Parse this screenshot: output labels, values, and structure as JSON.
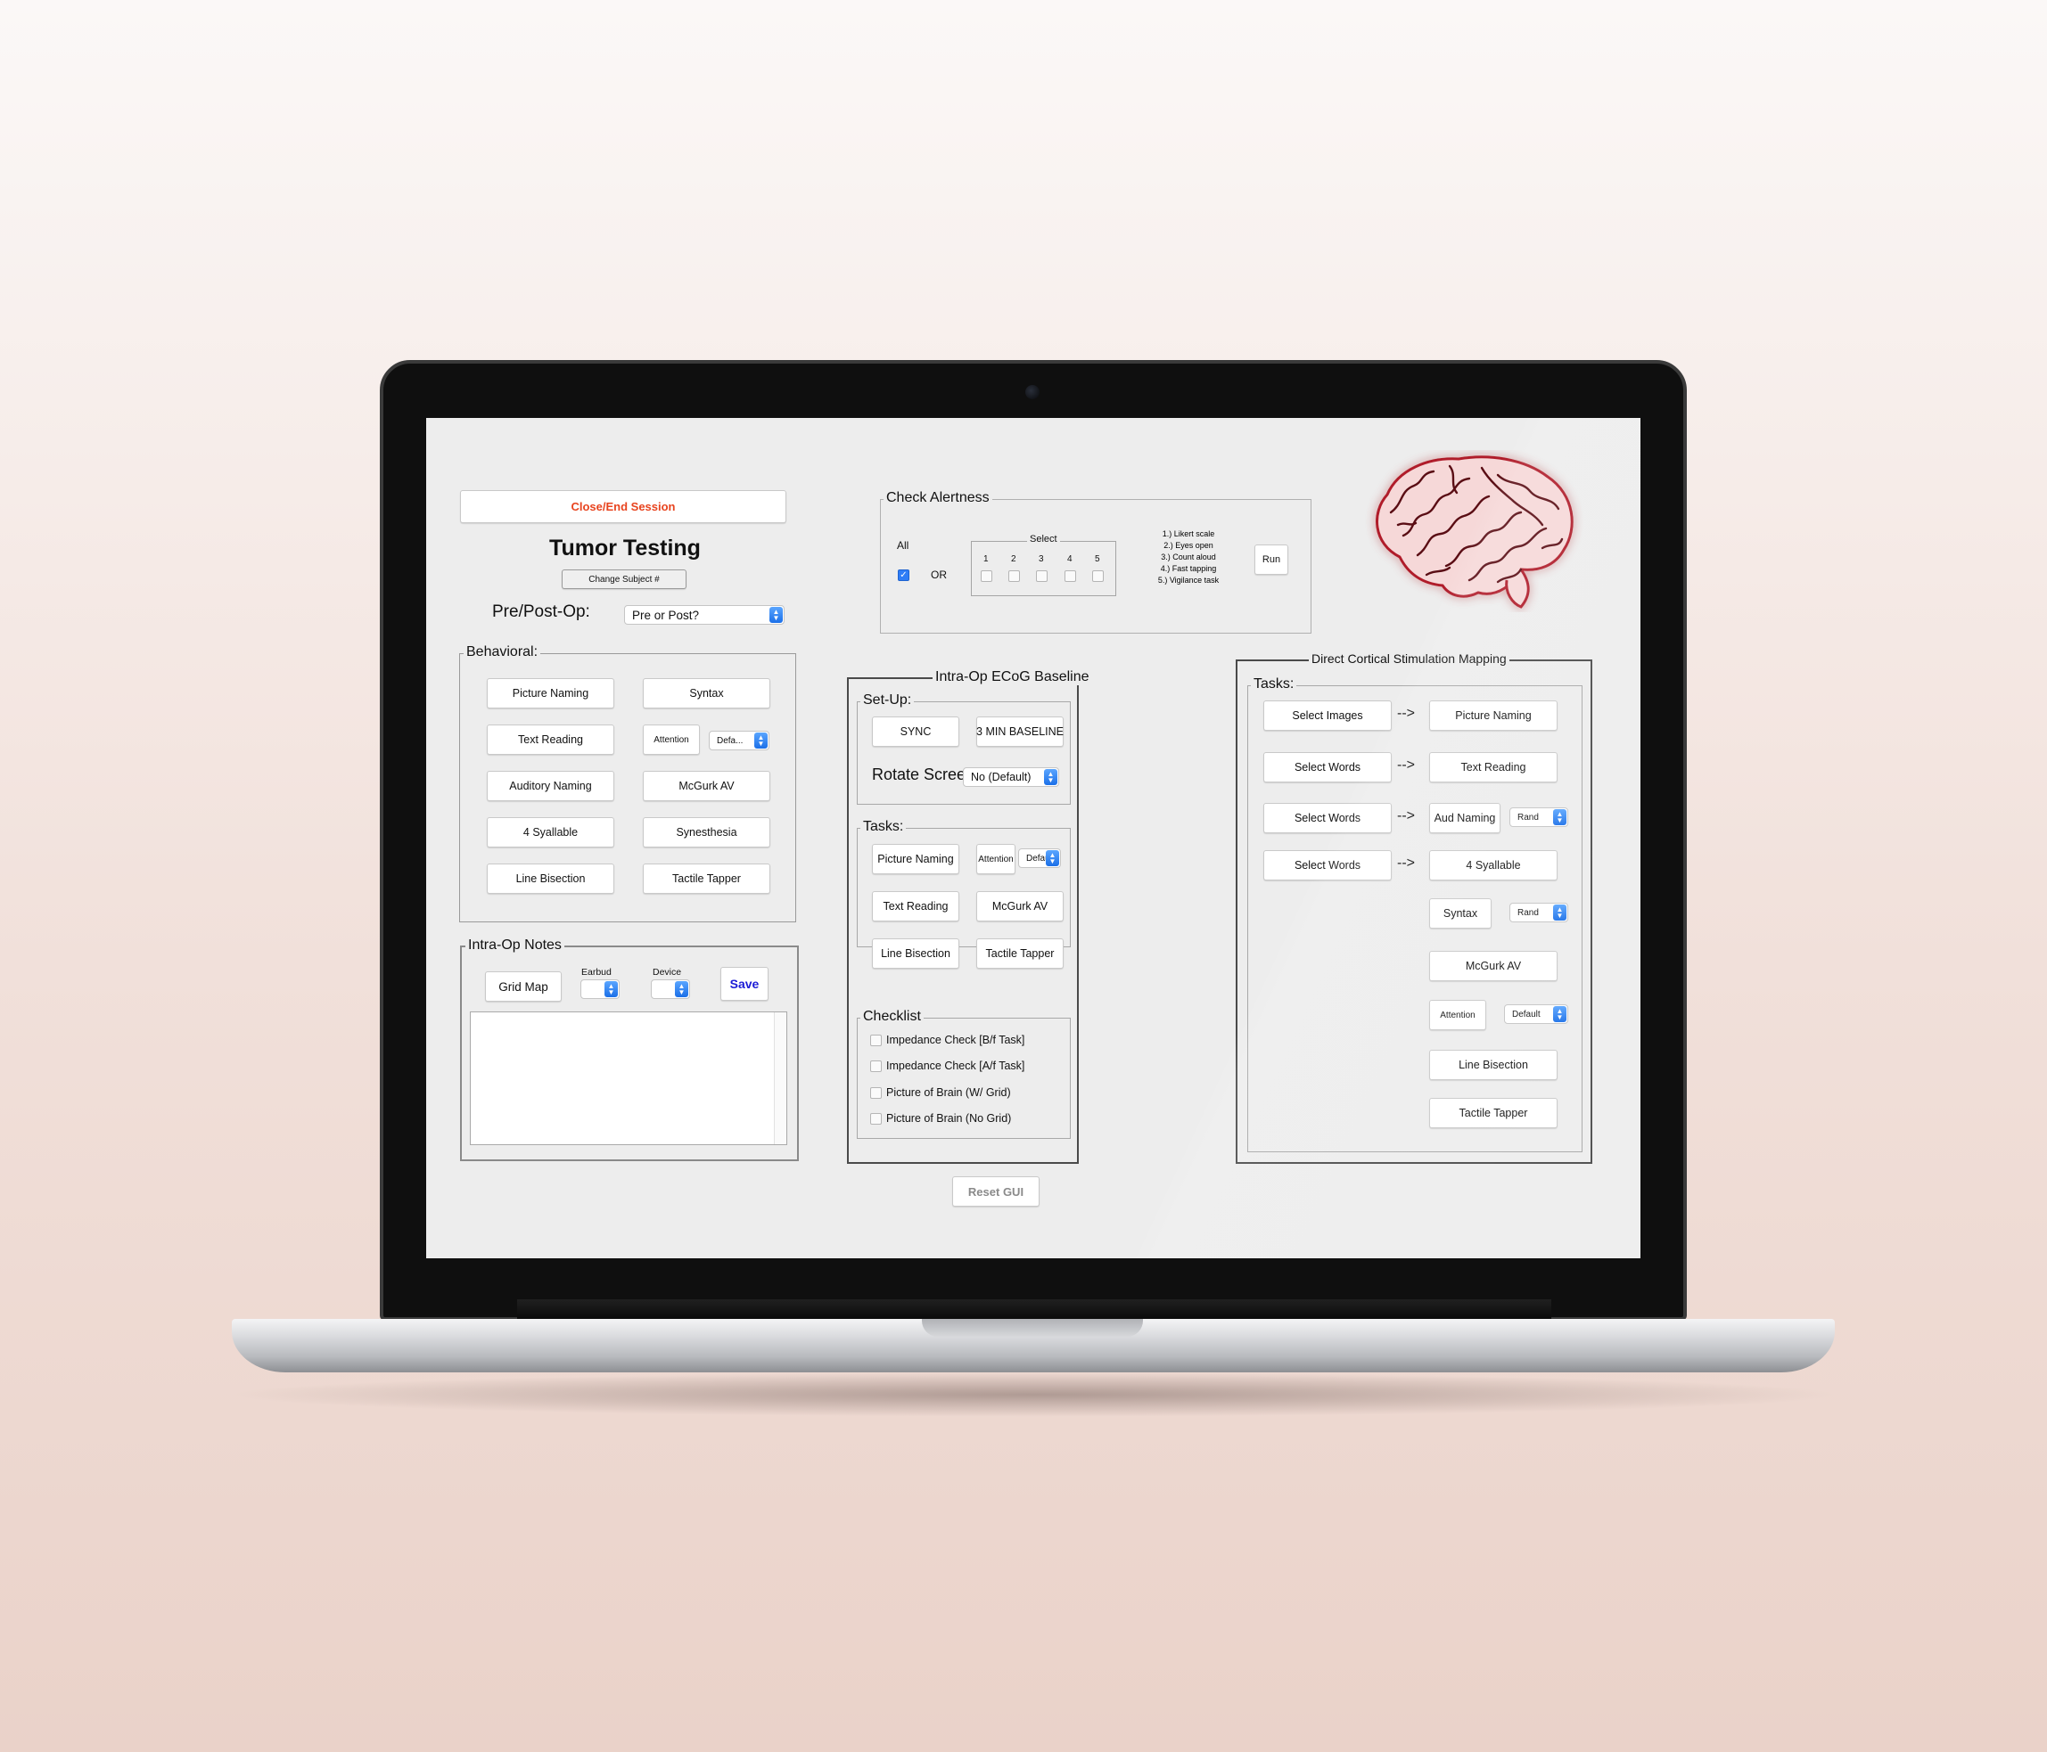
{
  "session": {
    "close_label": "Close/End Session",
    "close_color": "#e8441f"
  },
  "app": {
    "title": "Tumor Testing",
    "change_subject_label": "Change Subject #"
  },
  "prepost": {
    "label": "Pre/Post-Op:",
    "value": "Pre or Post?"
  },
  "behavioral": {
    "title": "Behavioral:",
    "left": [
      "Picture Naming",
      "Text Reading",
      "Auditory Naming",
      "4 Syallable",
      "Line Bisection"
    ],
    "right": [
      "Syntax",
      "McGurk AV",
      "Synesthesia",
      "Tactile Tapper"
    ],
    "attention_label": "Attention",
    "attention_value": "Defa..."
  },
  "notes": {
    "title": "Intra-Op Notes",
    "grid_map_label": "Grid Map",
    "earbud_label": "Earbud",
    "device_label": "Device",
    "save_label": "Save",
    "save_color": "#1b1bd6",
    "text": ""
  },
  "alertness": {
    "title": "Check Alertness",
    "all_label": "All",
    "or_label": "OR",
    "select_label": "Select",
    "numbers": [
      "1",
      "2",
      "3",
      "4",
      "5"
    ],
    "options": [
      "1.) Likert scale",
      "2.) Eyes open",
      "3.) Count aloud",
      "4.) Fast tapping",
      "5.) Vigilance task"
    ],
    "run_label": "Run",
    "all_checked": true
  },
  "ecog": {
    "title": "Intra-Op ECoG Baseline",
    "setup_title": "Set-Up:",
    "sync_label": "SYNC",
    "baseline_label": "3 MIN BASELINE",
    "rotate_label": "Rotate Screen?",
    "rotate_value": "No (Default)",
    "tasks_title": "Tasks:",
    "picture_naming": "Picture Naming",
    "attention_label": "Attention",
    "attention_value": "Default",
    "text_reading": "Text Reading",
    "mcgurk": "McGurk AV",
    "line_bisection": "Line Bisection",
    "tactile_tapper": "Tactile Tapper",
    "checklist_title": "Checklist",
    "checklist": [
      "Impedance Check [B/f Task]",
      "Impedance Check [A/f Task]",
      "Picture of Brain (W/ Grid)",
      "Picture of Brain (No Grid)"
    ]
  },
  "dcs": {
    "title": "Direct Cortical Stimulation Mapping",
    "tasks_title": "Tasks:",
    "arrow": "-->",
    "select_images": "Select Images",
    "select_words": "Select Words",
    "picture_naming": "Picture Naming",
    "text_reading": "Text Reading",
    "aud_naming": "Aud Naming",
    "syallable": "4 Syallable",
    "syntax": "Syntax",
    "rand": "Rand",
    "mcgurk": "McGurk AV",
    "attention_label": "Attention",
    "attention_value": "Default",
    "line_bisection": "Line Bisection",
    "tactile_tapper": "Tactile Tapper"
  },
  "reset_label": "Reset GUI"
}
